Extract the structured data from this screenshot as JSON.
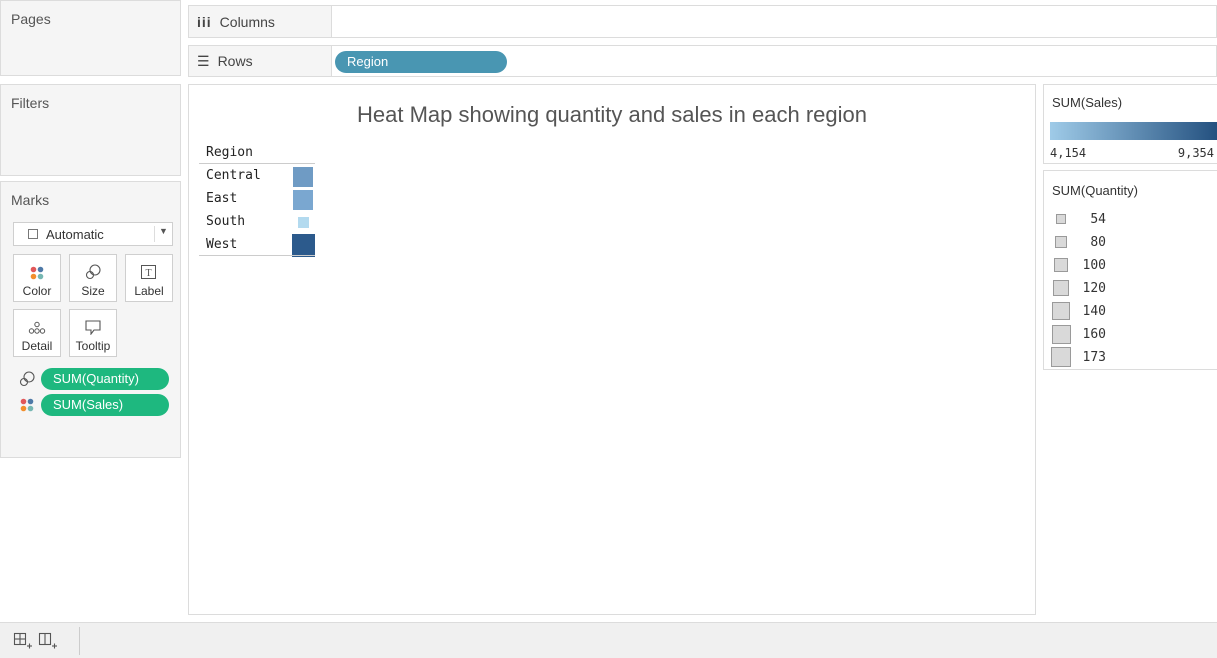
{
  "pages_panel": {
    "title": "Pages"
  },
  "filters_panel": {
    "title": "Filters"
  },
  "marks_panel": {
    "title": "Marks",
    "mark_type": "Automatic",
    "buttons": {
      "color": "Color",
      "size": "Size",
      "label": "Label",
      "detail": "Detail",
      "tooltip": "Tooltip"
    },
    "fields": [
      {
        "label": "SUM(Quantity)",
        "icon": "size-icon"
      },
      {
        "label": "SUM(Sales)",
        "icon": "color-icon"
      }
    ]
  },
  "shelves": {
    "columns_label": "Columns",
    "rows_label": "Rows",
    "rows_pill": "Region"
  },
  "view": {
    "title": "Heat Map showing quantity and sales in each region",
    "header": "Region"
  },
  "chart_data": {
    "type": "heatmap",
    "title": "Heat Map showing quantity and sales in each region",
    "row_header": "Region",
    "categories": [
      "Central",
      "East",
      "South",
      "West"
    ],
    "colors": [
      "#6f9bc4",
      "#7aa7d0",
      "#b3daef",
      "#2c5a8c"
    ],
    "size_levels": [
      1.0,
      1.0,
      0.55,
      1.15
    ]
  },
  "legends": {
    "sales": {
      "title": "SUM(Sales)",
      "min": "4,154",
      "max": "9,354",
      "gradient_start": "#9fcbe8",
      "gradient_end": "#23507f"
    },
    "quantity": {
      "title": "SUM(Quantity)",
      "items": [
        "54",
        "80",
        "100",
        "120",
        "140",
        "160",
        "173"
      ]
    }
  },
  "colors": {
    "pill_blue": "#4996b2",
    "pill_green": "#1eb87f"
  }
}
